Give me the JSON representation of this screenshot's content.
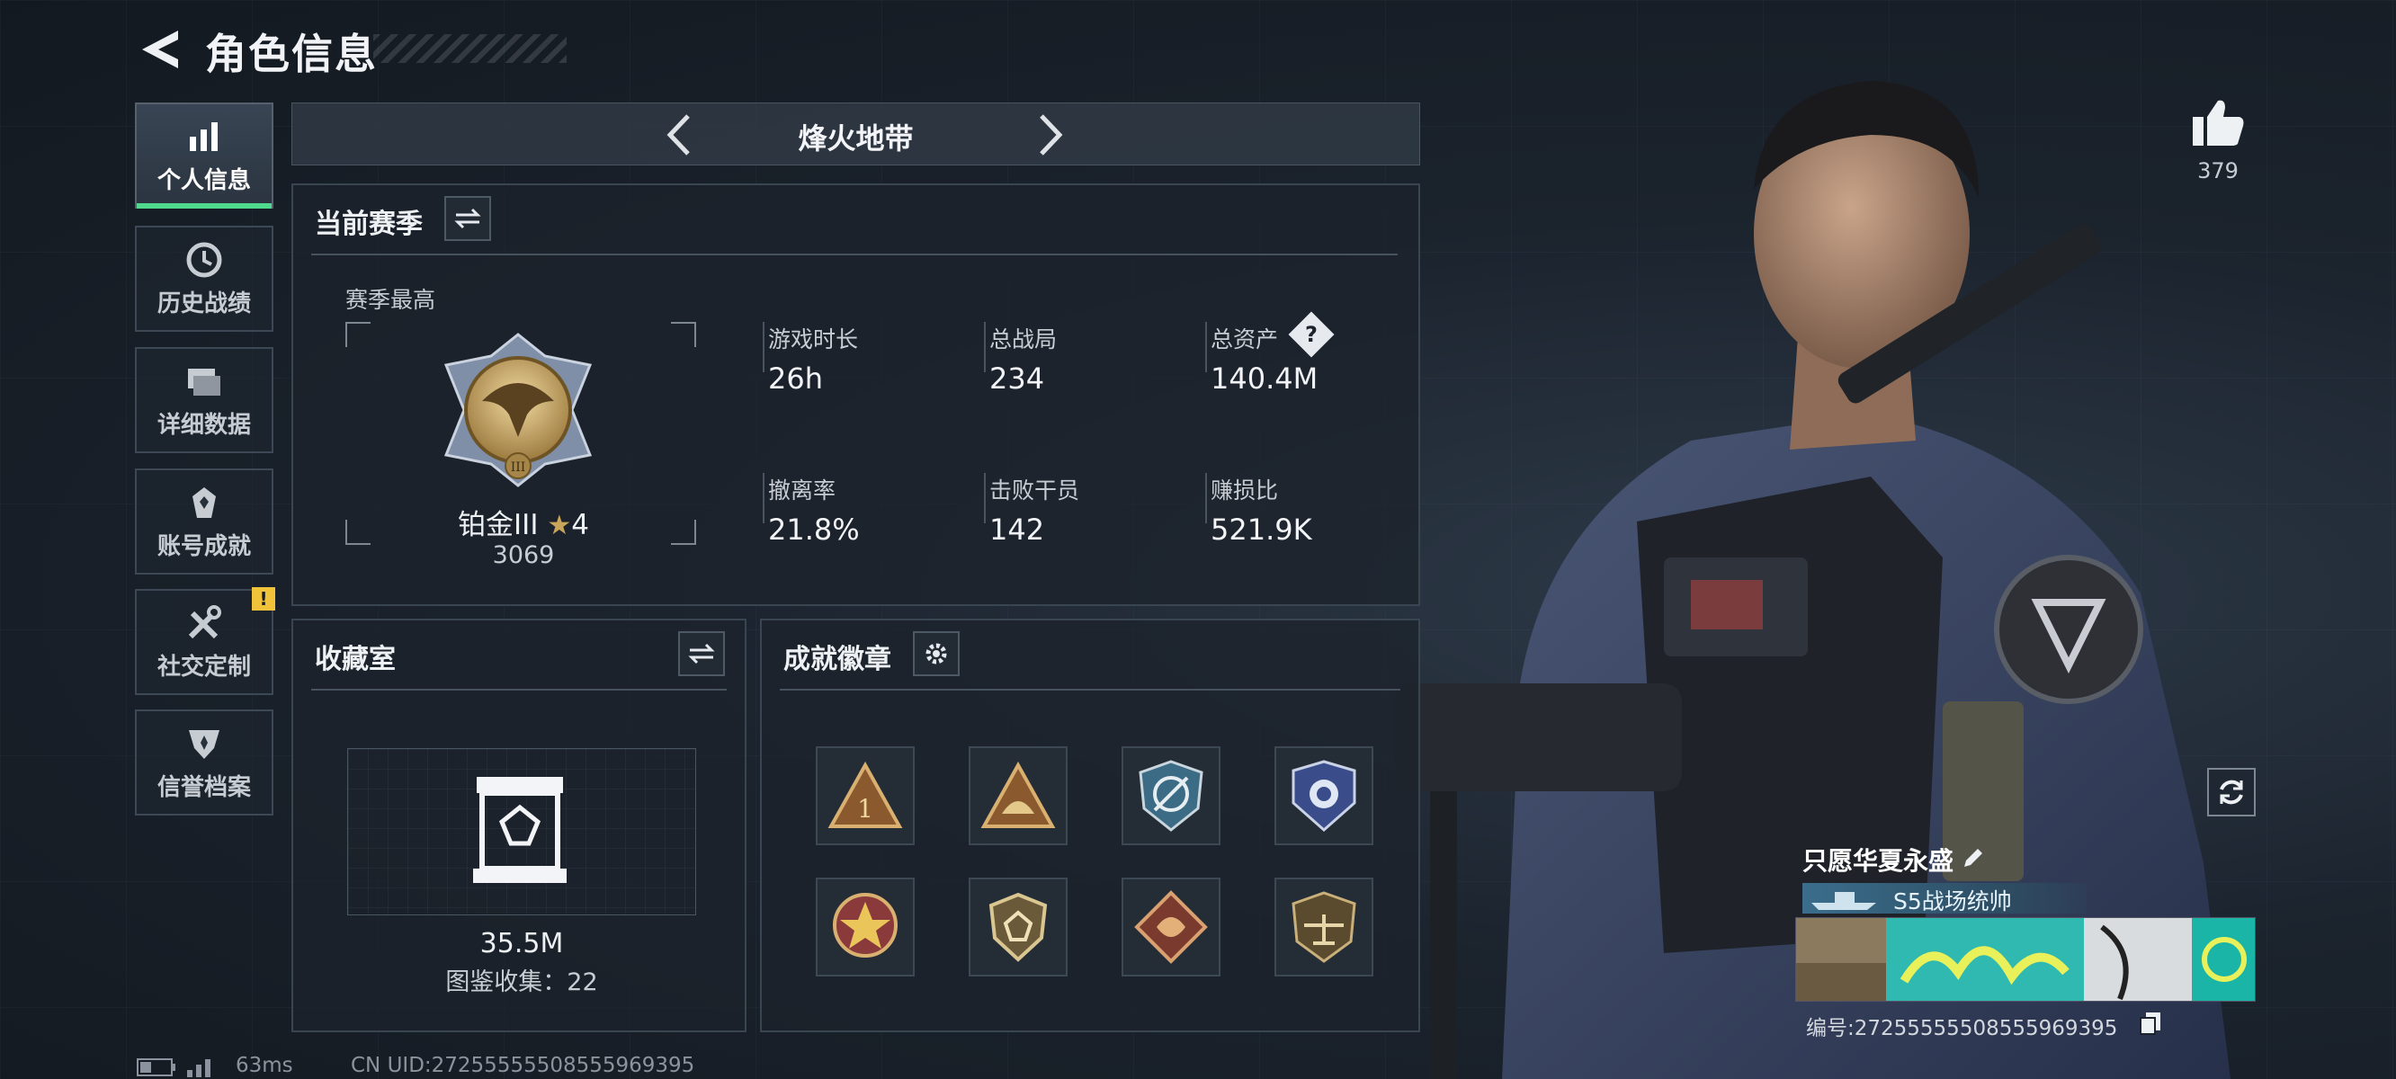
{
  "header": {
    "title": "角色信息"
  },
  "nav": {
    "items": [
      {
        "label": "个人信息",
        "active": true
      },
      {
        "label": "历史战绩"
      },
      {
        "label": "详细数据"
      },
      {
        "label": "账号成就"
      },
      {
        "label": "社交定制",
        "badge": "!"
      },
      {
        "label": "信誉档案"
      }
    ]
  },
  "mode": {
    "name": "烽火地带"
  },
  "season": {
    "title": "当前赛季",
    "best_label": "赛季最高",
    "rank_name": "铂金III",
    "rank_stars": "4",
    "rank_score": "3069",
    "stats": [
      {
        "label": "游戏时长",
        "value": "26h"
      },
      {
        "label": "总战局",
        "value": "234"
      },
      {
        "label": "总资产",
        "value": "140.4M",
        "help": "?"
      },
      {
        "label": "撤离率",
        "value": "21.8%"
      },
      {
        "label": "击败干员",
        "value": "142"
      },
      {
        "label": "赚损比",
        "value": "521.9K"
      }
    ]
  },
  "collection": {
    "title": "收藏室",
    "value": "35.5M",
    "collect_text": "图鉴收集：22"
  },
  "achievements": {
    "title": "成就徽章"
  },
  "profile": {
    "likes": "379",
    "player_name": "只愿华夏永盛",
    "title_chip": "S5战场统帅",
    "player_id": "编号:272555555085559693​95"
  },
  "status": {
    "ping": "63ms",
    "uid": "CN UID:272555555085559693​95"
  },
  "colors": {
    "accent_green": "#4ed98c",
    "gold": "#c9a55a",
    "panel": "#1c232c"
  }
}
